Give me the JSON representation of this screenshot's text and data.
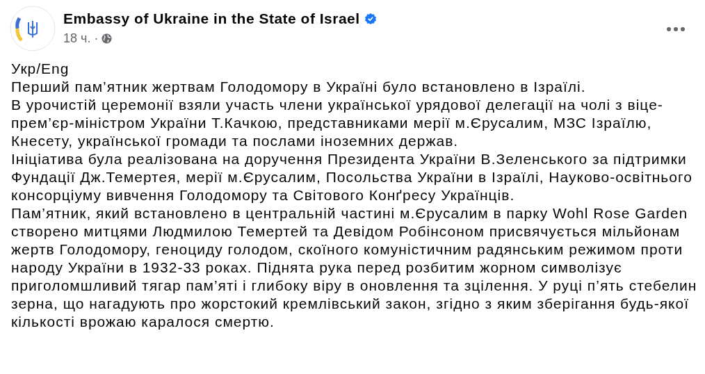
{
  "post": {
    "author": "Embassy of Ukraine in the State of Israel",
    "verified": true,
    "time": "18 ч.",
    "separator": "·",
    "paragraphs": [
      "Укр/Eng",
      "Перший пам’ятник жертвам Голодомору в Україні було встановлено в Ізраїлі.",
      "В урочистій церемонії взяли участь члени української урядової делегації на чолі з віце-прем’єр-міністром України Т.Качкою, представниками мерії м.Єрусалим, МЗС Ізраїлю, Кнесету, української громади та послами іноземних держав.",
      "Ініціатива була реалізована на доручення Президента України В.Зеленського за підтримки Фундації Дж.Темертея, мерії м.Єрусалим, Посольства України в Ізраїлі, Науково-освітнього консорціуму вивчення Голодомору та Світового Конґресу Українців.",
      "Пам’ятник, який встановлено в центральній частині м.Єрусалим в парку Wohl Rose Garden створено митцями Людмилою Темертей та Девідом Робінсоном присвячується мільйонам жертв Голодомору, геноциду голодом, скоїного комуністичним радянським режимом проти народу України в 1932-33 роках. Піднята рука перед розбитим жорном символізує приголомшливий тягар пам’яті і глибоку віру в оновлення та зцілення. У руці п’ять стебелин зерна, що нагадують про жорстокий кремлівський закон, згідно з яким зберігання будь-якої кількості врожаю каралося смертю."
    ]
  }
}
